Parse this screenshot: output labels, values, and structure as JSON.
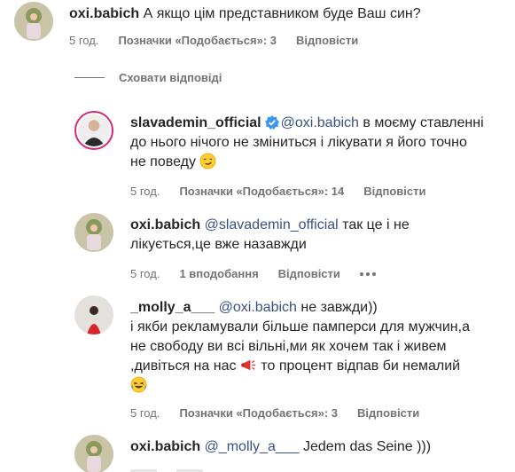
{
  "comments": [
    {
      "username": "oxi.babich",
      "text": "А якщо цім представником буде Ваш син?",
      "time": "5 год.",
      "likes": "Позначки «Подобається»: 3",
      "reply": "Відповісти"
    }
  ],
  "hide_replies": "Сховати відповіді",
  "replies": [
    {
      "username": "slavademin_official",
      "mention": "@oxi.babich",
      "line1": " в моєму ставленні",
      "line2": "до нього нічого не зміниться і лікувати я його точно",
      "line3": "не поведу",
      "time": "5 год.",
      "likes": "Позначки «Подобається»: 14",
      "reply": "Відповісти",
      "verified_color": "#3897f0"
    },
    {
      "username": "oxi.babich",
      "mention": "@slavademin_official",
      "line1": " так це і не",
      "line2": "лікується,це вже назавжди",
      "time": "5 год.",
      "likes": "1 вподобання",
      "reply": "Відповісти"
    },
    {
      "username": "_molly_a___",
      "mention": "@oxi.babich",
      "line1": " не завжди))",
      "line2": "і якби рекламували більше памперси для мужчин,а",
      "line3": "не свободу ви всі вільні,ми як хочем так і живем",
      "line4a": ",дивіться на нас ",
      "line4b": " то процент відпав би немалий",
      "time": "5 год.",
      "likes": "Позначки «Подобається»: 3",
      "reply": "Відповісти"
    },
    {
      "username": "oxi.babich",
      "mention": "@_molly_a___",
      "line1": " Jedem das Seine )))"
    }
  ],
  "icons": [
    "verified-badge-icon",
    "smirk-emoji-icon",
    "megaphone-emoji-icon",
    "laughing-emoji-icon",
    "more-options-icon"
  ]
}
